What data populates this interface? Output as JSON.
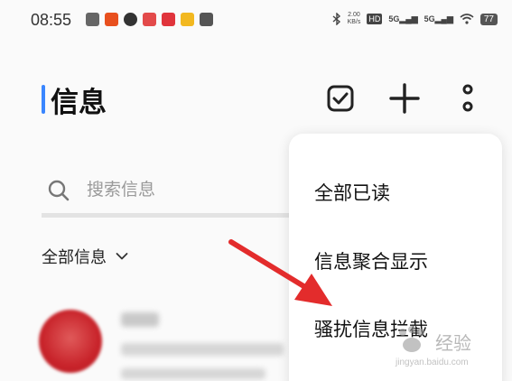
{
  "status_bar": {
    "time": "08:55",
    "speed_value": "2.00",
    "speed_unit": "KB/s",
    "hd_label": "HD",
    "signal_1": "5G",
    "signal_2": "5G",
    "battery": "77"
  },
  "header": {
    "title": "信息"
  },
  "search": {
    "placeholder": "搜索信息"
  },
  "filter": {
    "label": "全部信息"
  },
  "popup_menu": {
    "items": [
      {
        "label": "全部已读"
      },
      {
        "label": "信息聚合显示"
      },
      {
        "label": "骚扰信息拦截"
      }
    ]
  },
  "watermark": {
    "text": "经验",
    "sub": "jingyan.baidu.com"
  },
  "colors": {
    "accent": "#3a86ff",
    "arrow": "#e32c2c",
    "avatar": "#c8232a"
  }
}
